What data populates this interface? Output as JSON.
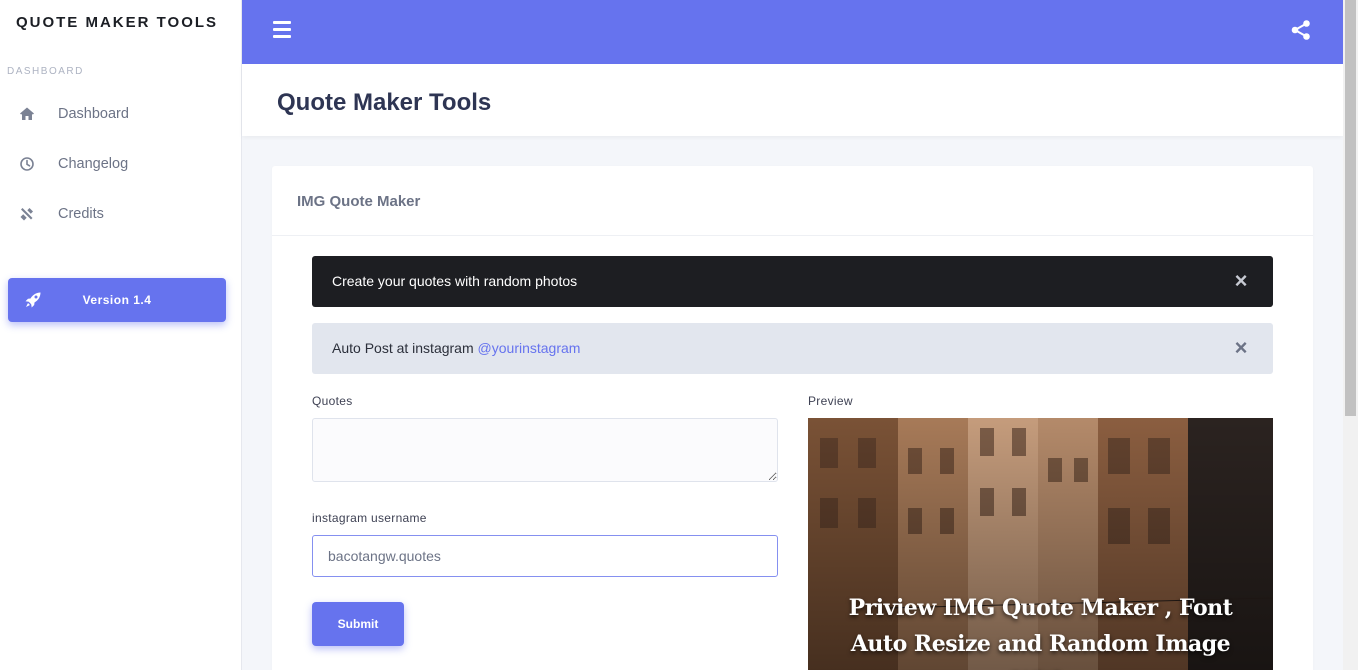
{
  "sidebar": {
    "brand": "QUOTE MAKER TOOLS",
    "heading": "DASHBOARD",
    "items": [
      {
        "label": "Dashboard",
        "icon": "home-icon"
      },
      {
        "label": "Changelog",
        "icon": "clock-icon"
      },
      {
        "label": "Credits",
        "icon": "tools-icon"
      }
    ],
    "version_label": "Version 1.4",
    "version_icon": "rocket-icon"
  },
  "topbar": {
    "menu_icon": "hamburger-icon",
    "share_icon": "share-icon",
    "accent_color": "#6673ee"
  },
  "page": {
    "title": "Quote Maker Tools"
  },
  "card": {
    "title": "IMG Quote Maker",
    "alerts": [
      {
        "text": "Create your quotes with random photos",
        "close": "×"
      },
      {
        "text": "Auto Post at instagram ",
        "link": "@yourinstagram",
        "close": "×"
      }
    ],
    "form": {
      "quotes_label": "Quotes",
      "quotes_value": "",
      "username_label": "instagram username",
      "username_value": "bacotangw.quotes",
      "submit_label": "Submit"
    },
    "preview": {
      "label": "Preview",
      "overlay_text": "Priview IMG Quote Maker , Font Auto Resize and Random Image With"
    }
  }
}
